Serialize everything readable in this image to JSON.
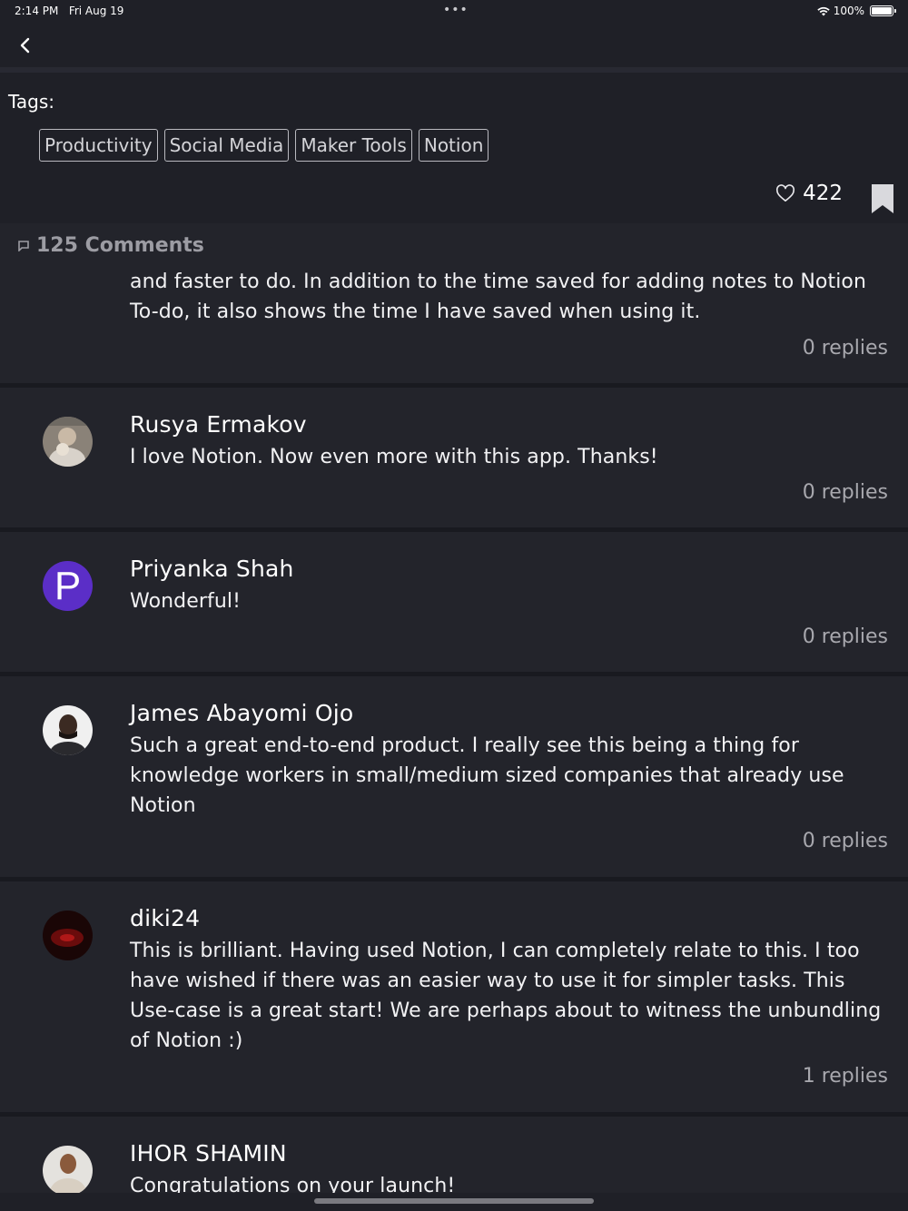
{
  "status_bar": {
    "time": "2:14 PM",
    "date": "Fri Aug 19",
    "battery": "100%"
  },
  "tags": {
    "label": "Tags:",
    "items": [
      "Productivity",
      "Social Media",
      "Maker Tools",
      "Notion"
    ]
  },
  "likes": {
    "count": "422"
  },
  "comments": {
    "header": "125 Comments",
    "items": [
      {
        "author": "",
        "text": "and faster to do. In addition to the time saved for adding notes to Notion To-do, it also shows the time I have saved when using it.",
        "replies": "0 replies"
      },
      {
        "author": "Rusya Ermakov",
        "text": "I love Notion. Now even more with this app. Thanks!",
        "replies": "0 replies"
      },
      {
        "author": "Priyanka Shah",
        "avatar_letter": "P",
        "avatar_color": "#5b2ec7",
        "text": "Wonderful!",
        "replies": "0 replies"
      },
      {
        "author": "James Abayomi Ojo",
        "text": "Such a great end-to-end product. I really see this being a thing for knowledge workers in small/medium sized companies that already use Notion",
        "replies": "0 replies"
      },
      {
        "author": "diki24",
        "text": "This is brilliant. Having used Notion, I can completely relate to this. I too have wished if there was an easier way to use it for simpler tasks. This Use-case is a great start! We are perhaps about to witness the unbundling of Notion :)",
        "replies": "1 replies"
      },
      {
        "author": "IHOR SHAMIN",
        "text": "Congratulations on your launch!",
        "replies": ""
      }
    ]
  },
  "colors": {
    "background": "#1f2027",
    "comment_background": "#23242b",
    "muted_text": "#a8a8ae"
  }
}
